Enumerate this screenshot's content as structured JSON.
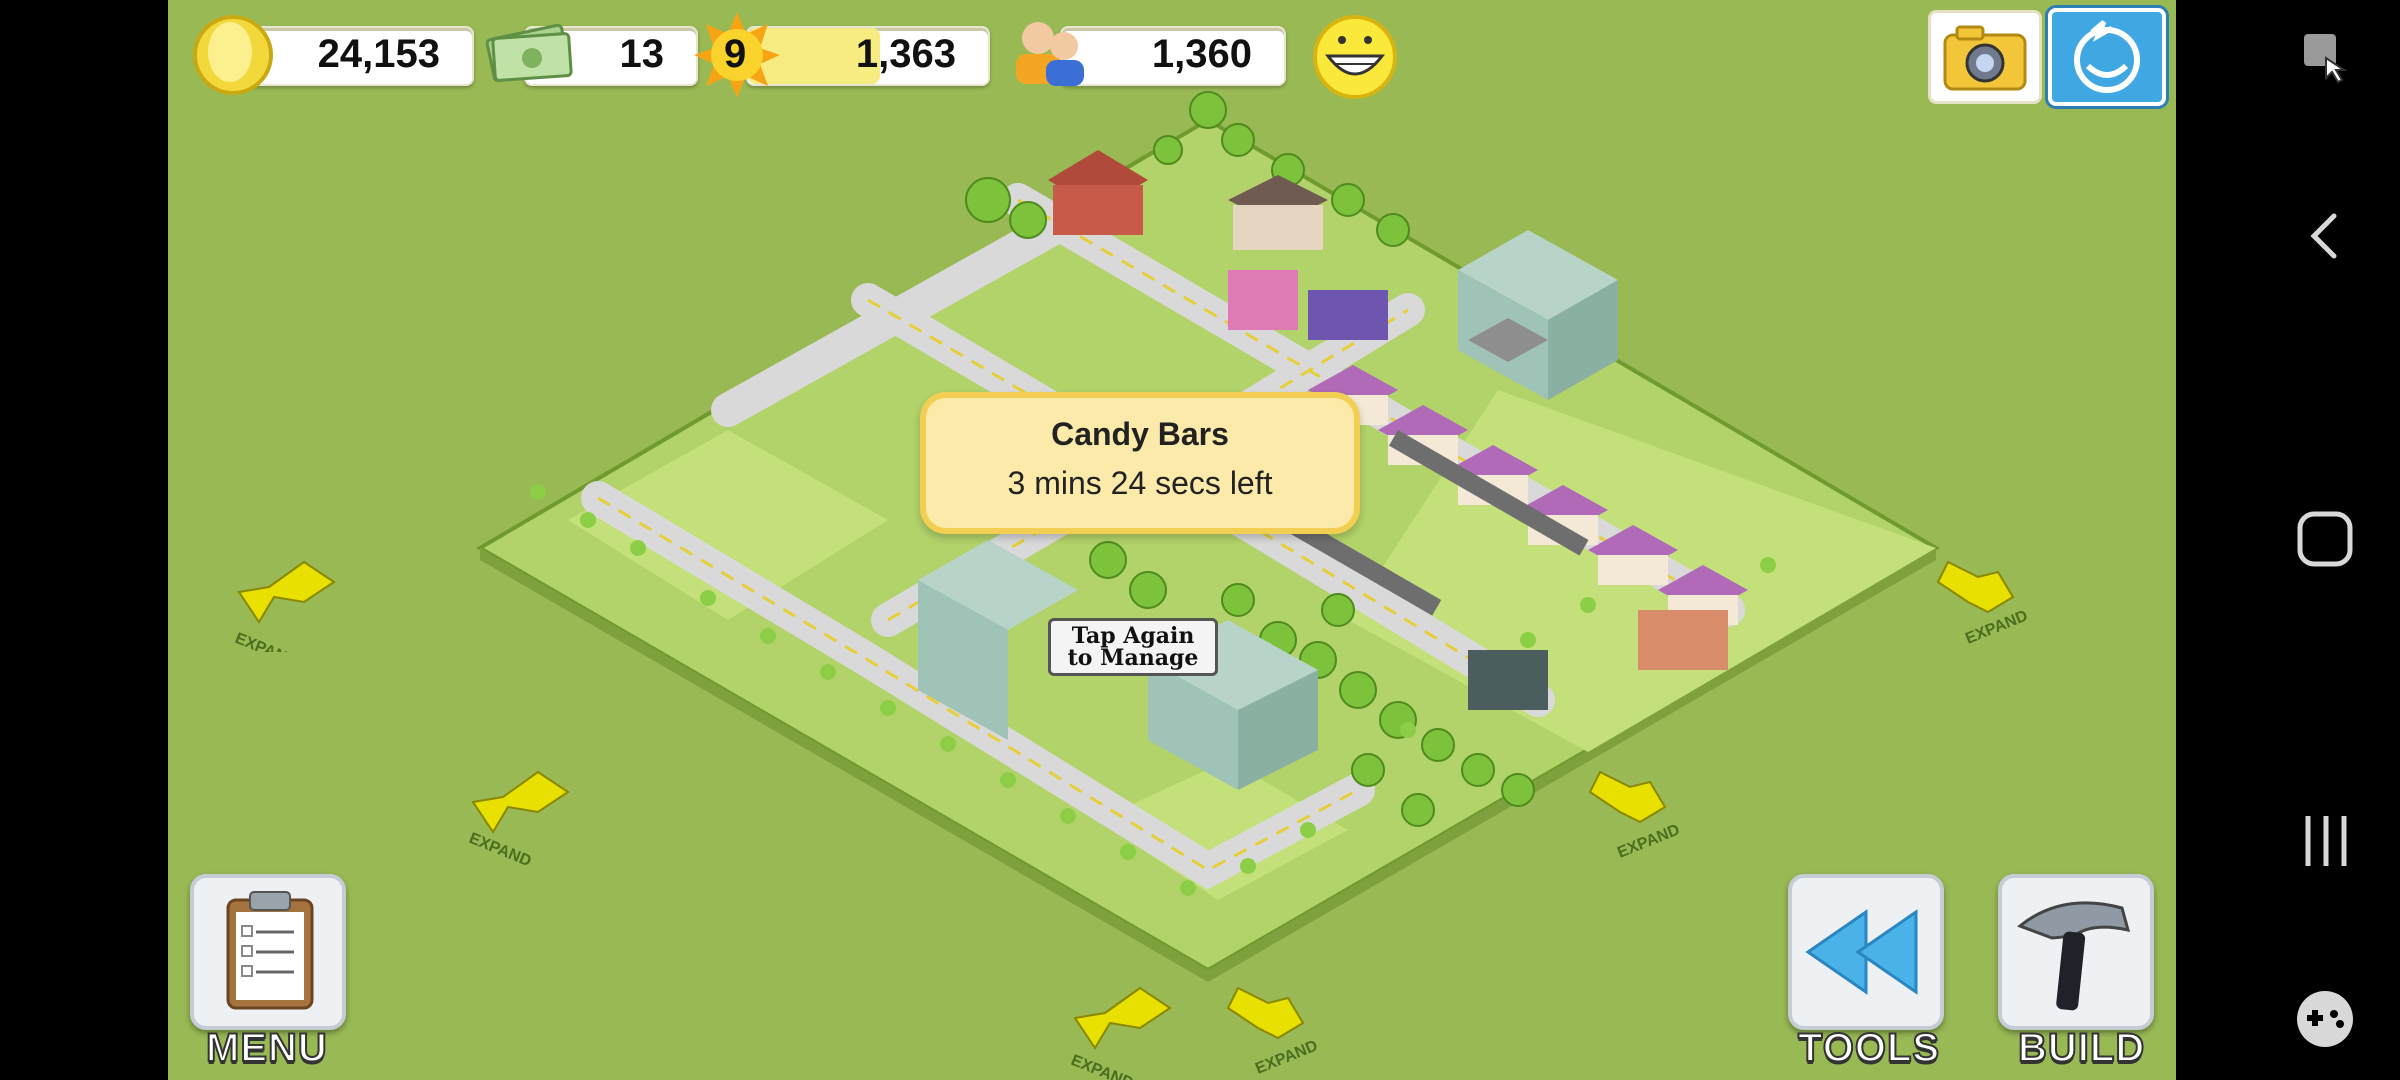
{
  "hud": {
    "coins": "24,153",
    "cash": "13",
    "level": "9",
    "xp": "1,363",
    "xp_fraction": 0.55,
    "population": "1,360"
  },
  "tooltip": {
    "title": "Candy Bars",
    "subtitle": "3 mins 24 secs left"
  },
  "sign": {
    "line1": "Tap Again",
    "line2": "to Manage"
  },
  "expand_label": "EXPAND",
  "buttons": {
    "menu": "MENU",
    "tools": "TOOLS",
    "build": "BUILD"
  },
  "colors": {
    "grass": "#98b954",
    "tooltip_bg": "#fbeaa9",
    "tooltip_border": "#f2cf52",
    "arrow": "#e7e000"
  }
}
